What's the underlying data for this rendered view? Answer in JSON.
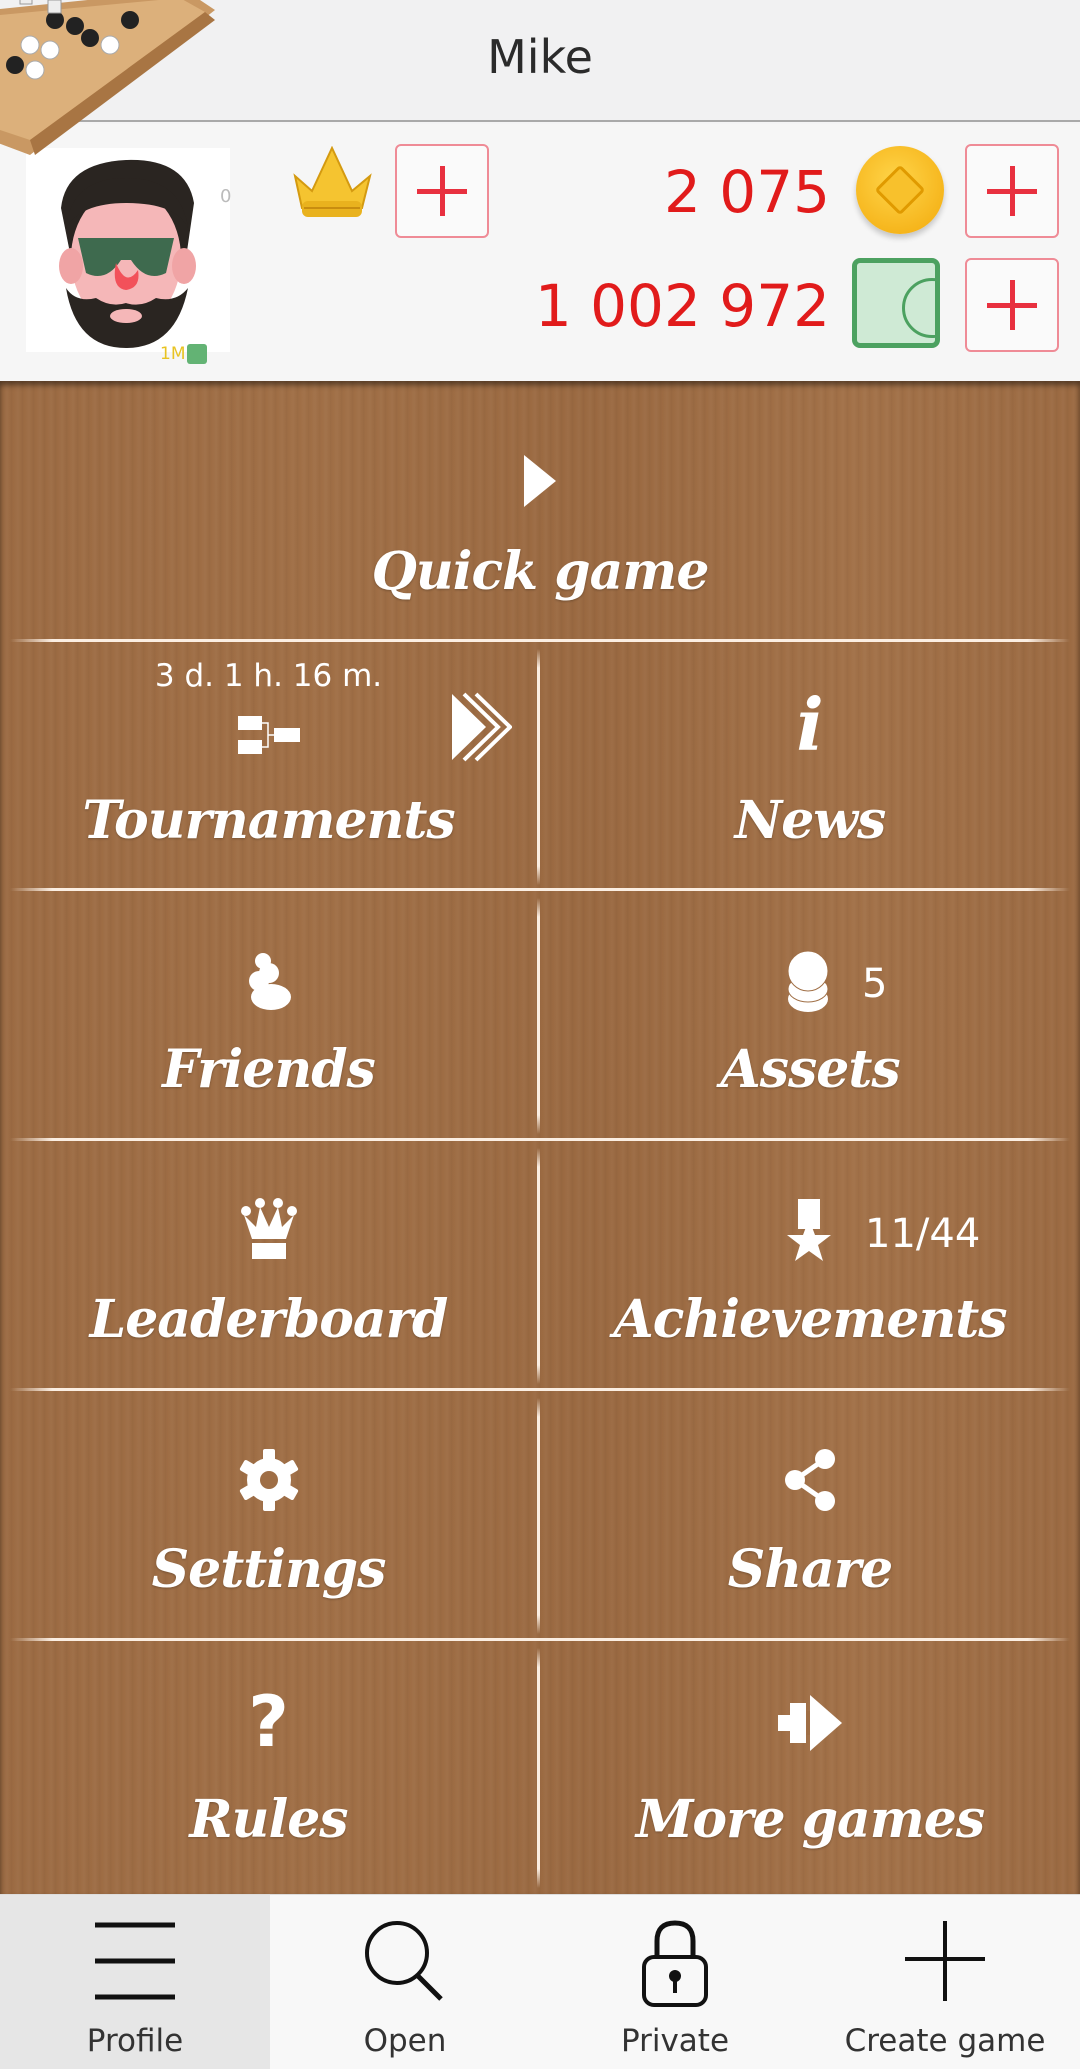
{
  "header": {
    "title": "Mike"
  },
  "profile": {
    "avatar_badge": "0",
    "million_badge": "1M",
    "gold_amount": "2 075",
    "cash_amount": "1 002 972"
  },
  "menu": {
    "quick_game": "Quick game",
    "tournaments": {
      "label": "Tournaments",
      "timer": "3 d. 1 h. 16 m."
    },
    "news": "News",
    "friends": "Friends",
    "assets": {
      "label": "Assets",
      "count": "5"
    },
    "leaderboard": "Leaderboard",
    "achievements": {
      "label": "Achievements",
      "count": "11/44"
    },
    "settings": "Settings",
    "share": "Share",
    "rules": "Rules",
    "more_games": "More games"
  },
  "bottom_nav": {
    "items": [
      {
        "label": "Profile",
        "icon": "menu-icon",
        "active": true
      },
      {
        "label": "Open",
        "icon": "search-icon",
        "active": false
      },
      {
        "label": "Private",
        "icon": "lock-icon",
        "active": false
      },
      {
        "label": "Create game",
        "icon": "plus-icon",
        "active": false
      }
    ]
  },
  "colors": {
    "wood": "#9c6b43",
    "amount_red": "#e11b1b",
    "plus_red": "#e8303f",
    "divider": "#fbeee2"
  }
}
